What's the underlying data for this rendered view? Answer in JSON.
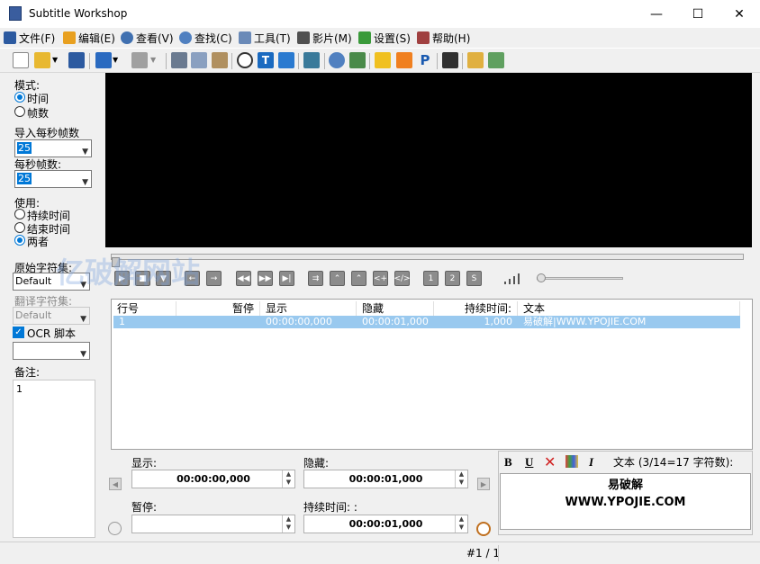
{
  "window": {
    "title": "Subtitle Workshop",
    "minimize": "—",
    "maximize": "☐",
    "close": "✕"
  },
  "menu": [
    {
      "label": "文件(F)",
      "icon": "save-icon",
      "color": "#2c5aa0"
    },
    {
      "label": "编辑(E)",
      "icon": "edit-icon",
      "color": "#e8a020"
    },
    {
      "label": "查看(V)",
      "icon": "eye-icon",
      "color": "#4070b0"
    },
    {
      "label": "查找(C)",
      "icon": "magnifier-icon",
      "color": "#5080c0"
    },
    {
      "label": "工具(T)",
      "icon": "wrench-icon",
      "color": "#6a8ab8"
    },
    {
      "label": "影片(M)",
      "icon": "film-icon",
      "color": "#505050"
    },
    {
      "label": "设置(S)",
      "icon": "checkbox-settings-icon",
      "color": "#3a9a3a"
    },
    {
      "label": "帮助(H)",
      "icon": "book-icon",
      "color": "#a04040"
    }
  ],
  "left": {
    "mode_label": "模式:",
    "mode_time": "时间",
    "mode_frames": "帧数",
    "import_fps_label": "导入每秒帧数",
    "import_fps_value": "25",
    "fps_label": "每秒帧数:",
    "fps_value": "25",
    "use_label": "使用:",
    "use_duration": "持续时间",
    "use_end": "结束时间",
    "use_both": "两者",
    "orig_charset_label": "原始字符集:",
    "orig_charset_value": "Default",
    "trans_charset_label": "翻译字符集:",
    "trans_charset_value": "Default",
    "ocr_label": "OCR 脚本",
    "notes_label": "备注:",
    "notes_value": "1"
  },
  "watermark": "亿破解网站",
  "list": {
    "headers": [
      "行号",
      "暂停",
      "显示",
      "隐藏",
      "持续时间:",
      "文本"
    ],
    "rows": [
      {
        "num": "1",
        "pause": "",
        "show": "00:00:00,000",
        "hide": "00:00:01,000",
        "duration": "1,000",
        "text": "易破解|WWW.YPOJIE.COM"
      }
    ]
  },
  "edit": {
    "show_label": "显示:",
    "show_value": "00:00:00,000",
    "hide_label": "隐藏:",
    "hide_value": "00:00:01,000",
    "pause_label": "暂停:",
    "pause_value": "",
    "duration_label": "持续时间: :",
    "duration_value": "00:00:01,000"
  },
  "text_panel": {
    "bold": "B",
    "underline": "U",
    "italic": "I",
    "header": "文本 (3/14=17 字符数):",
    "line1": "易破解",
    "line2": "WWW.YPOJIE.COM"
  },
  "status": "#1 / 1"
}
